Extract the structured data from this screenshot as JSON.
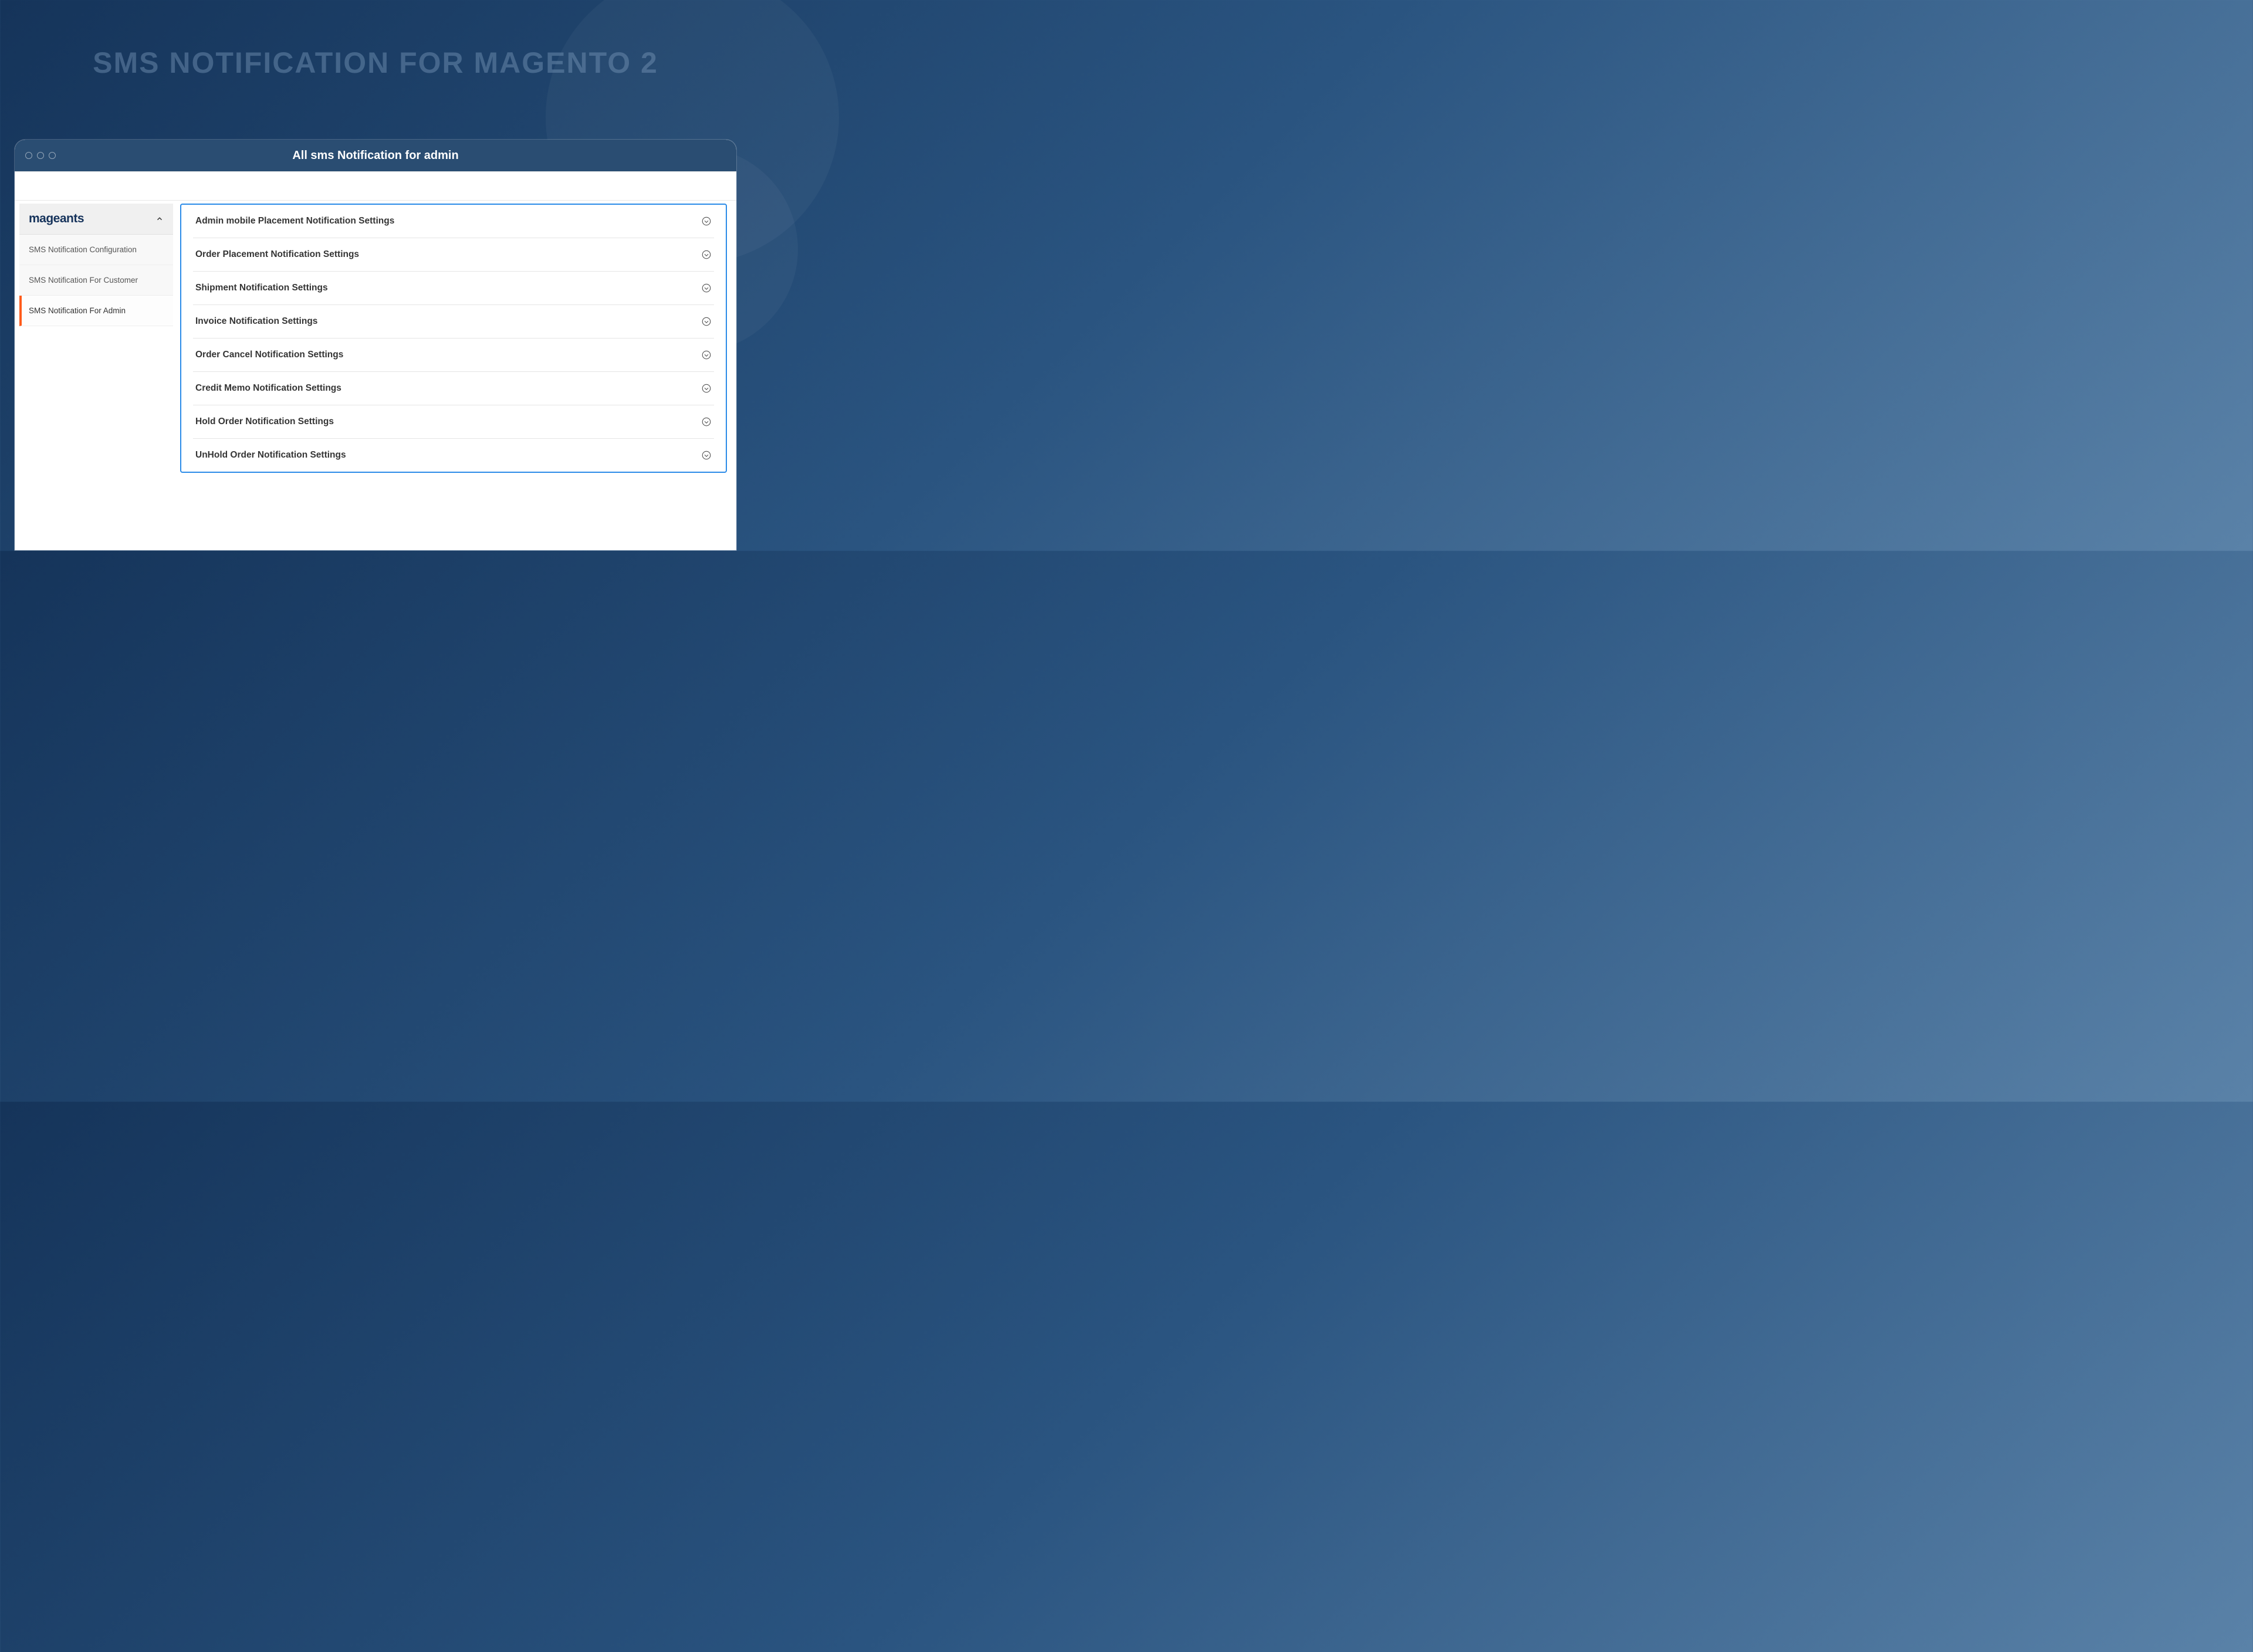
{
  "hero_title": "SMS NOTIFICATION FOR MAGENTO 2",
  "browser_title": "All sms Notification for admin",
  "sidebar": {
    "logo": "mageants",
    "items": [
      {
        "label": "SMS Notification Configuration",
        "active": false
      },
      {
        "label": "SMS Notification For Customer",
        "active": false
      },
      {
        "label": "SMS Notification For Admin",
        "active": true
      }
    ]
  },
  "settings": [
    {
      "label": "Admin mobile Placement Notification Settings"
    },
    {
      "label": "Order Placement Notification Settings"
    },
    {
      "label": "Shipment Notification Settings"
    },
    {
      "label": "Invoice Notification Settings"
    },
    {
      "label": "Order Cancel Notification Settings"
    },
    {
      "label": "Credit Memo Notification Settings"
    },
    {
      "label": "Hold Order Notification Settings"
    },
    {
      "label": "UnHold Order Notification Settings"
    }
  ]
}
